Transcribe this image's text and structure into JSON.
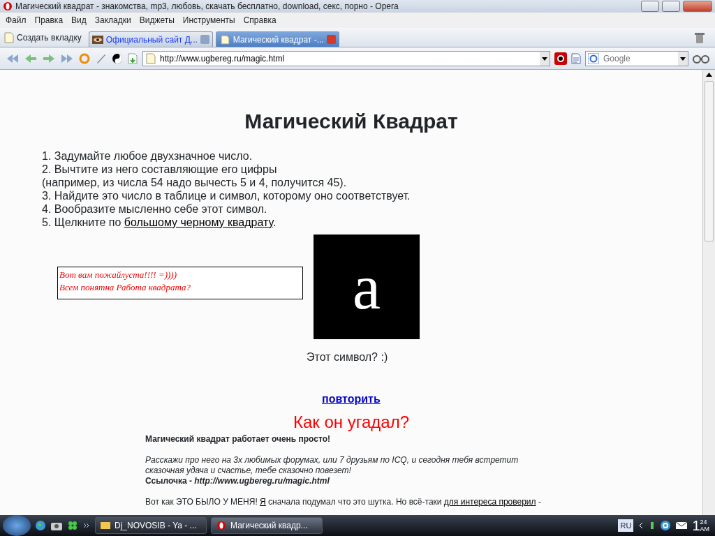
{
  "window": {
    "title": "Магический квадрат - знакомства, mp3, любовь, скачать бесплатно, download, секс, порно - Opera"
  },
  "menu": [
    "Файл",
    "Правка",
    "Вид",
    "Закладки",
    "Виджеты",
    "Инструменты",
    "Справка"
  ],
  "new_tab": "Создать вкладку",
  "tabs": [
    {
      "label": "Официальный сайт Д...",
      "selected": false
    },
    {
      "label": "Магический квадрат -...",
      "selected": true
    }
  ],
  "address": {
    "value": "http://www.ugbereg.ru/magic.html"
  },
  "search": {
    "placeholder": "Google"
  },
  "page": {
    "title": "Магический Квадрат",
    "steps": [
      "1. Задумайте любое двухзначное число.",
      "2. Вычтите из него составляющие его цифры",
      "(например, из числа 54 надо вычесть 5 и 4, получится 45).",
      "3. Найдите это число в таблице и символ, которому оно соответствует.",
      "4. Вообразите мысленно себе этот символ."
    ],
    "last_step": {
      "text": "5. Щелкните по ",
      "link": "большому черному квадрату",
      "end": "."
    },
    "comment": [
      "Вот вам пожайлуста!!!! =))))",
      "Всем понятна Работа квадрата?"
    ],
    "symbol": "a",
    "question": "Этот символ? :)",
    "repeat_link": "повторить",
    "heading": "Как он угадал?",
    "intro": "Магический квадрат работает очень просто!",
    "share": "Расскажи про него на 3х любимых форумах, или 7 друзьям по ICQ, и сегодня тебя встретит сказочная удача и счастье, тебе сказочно повезет!",
    "link_line": "Ссылочка - *http://www.ugbereg.ru/magic.html*",
    "story": [
      {
        "text": "Вот как ЭТО БЫЛО У МЕНЯ! ",
        "link": false
      },
      {
        "text": "Я",
        "link": true
      },
      {
        "text": " сначала подумал что это шутка. Но всё-таки ",
        "link": false
      },
      {
        "text": "для интереса проверил",
        "link": true
      },
      {
        "text": " -",
        "link": false
      }
    ]
  },
  "taskbar": {
    "tasks": [
      {
        "label": "Dj_NOVOSIB - Ya  - ...",
        "selected": false
      },
      {
        "label": "Магический квадр...",
        "selected": true
      }
    ],
    "language": "RU",
    "clock": [
      "1",
      "24",
      "AM"
    ]
  }
}
